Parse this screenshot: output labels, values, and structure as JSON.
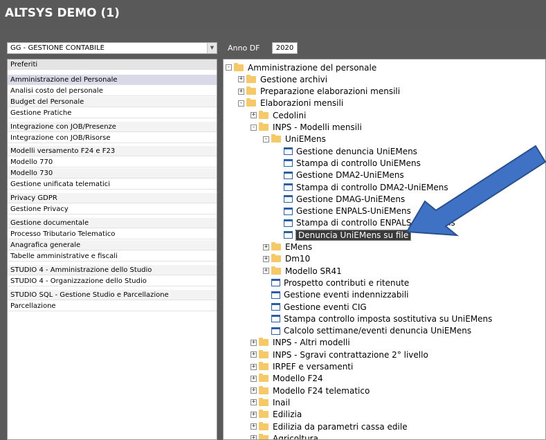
{
  "window": {
    "title": "ALTSYS DEMO (1)"
  },
  "module_select": {
    "value": "GG - GESTIONE CONTABILE"
  },
  "anno": {
    "label": "Anno DF",
    "value": "2020"
  },
  "left_menu": [
    {
      "label": "Preferiti",
      "kind": "header"
    },
    {
      "label": "Amministrazione del Personale",
      "kind": "selected"
    },
    {
      "label": "Analisi costo del personale"
    },
    {
      "label": "Budget del Personale"
    },
    {
      "label": "Gestione Pratiche"
    },
    {
      "label": "Integrazione con JOB/Presenze"
    },
    {
      "label": "Integrazione con JOB/Risorse"
    },
    {
      "label": "Modelli versamento F24 e F23"
    },
    {
      "label": "Modello 770"
    },
    {
      "label": "Modello 730"
    },
    {
      "label": "Gestione unificata telematici"
    },
    {
      "label": "Privacy GDPR"
    },
    {
      "label": "Gestione Privacy"
    },
    {
      "label": "Gestione documentale"
    },
    {
      "label": "Processo Tributario Telematico"
    },
    {
      "label": "Anagrafica generale"
    },
    {
      "label": "Tabelle amministrative e fiscali"
    },
    {
      "label": "STUDIO 4 - Amministrazione dello Studio"
    },
    {
      "label": "STUDIO 4 - Organizzazione dello Studio"
    },
    {
      "label": "STUDIO SQL - Gestione Studio e Parcellazione"
    },
    {
      "label": "Parcellazione"
    }
  ],
  "tree": [
    {
      "label": "Amministrazione del personale",
      "icon": "folder",
      "toggle": "-"
    },
    {
      "label": "Gestione archivi",
      "icon": "folder",
      "toggle": "+"
    },
    {
      "label": "Preparazione elaborazioni mensili",
      "icon": "folder",
      "toggle": "+"
    },
    {
      "label": "Elaborazioni mensili",
      "icon": "folder",
      "toggle": "-"
    },
    {
      "label": "Cedolini",
      "icon": "folder",
      "toggle": "+"
    },
    {
      "label": "INPS - Modelli mensili",
      "icon": "folder",
      "toggle": "-"
    },
    {
      "label": "UniEMens",
      "icon": "folder",
      "toggle": "-"
    },
    {
      "label": "Gestione denuncia UniEMens",
      "icon": "doc"
    },
    {
      "label": "Stampa di controllo UniEMens",
      "icon": "doc"
    },
    {
      "label": "Gestione DMA2-UniEMens",
      "icon": "doc"
    },
    {
      "label": "Stampa di controllo DMA2-UniEMens",
      "icon": "doc"
    },
    {
      "label": "Gestione DMAG-UniEMens",
      "icon": "doc"
    },
    {
      "label": "Gestione ENPALS-UniEMens",
      "icon": "doc"
    },
    {
      "label": "Stampa di controllo ENPALS-UniEMens",
      "icon": "doc"
    },
    {
      "label": "Denuncia UniEMens su file",
      "icon": "doc",
      "selected": true
    },
    {
      "label": "EMens",
      "icon": "folder",
      "toggle": "+"
    },
    {
      "label": "Dm10",
      "icon": "folder",
      "toggle": "+"
    },
    {
      "label": "Modello SR41",
      "icon": "folder",
      "toggle": "+"
    },
    {
      "label": "Prospetto contributi e ritenute",
      "icon": "doc"
    },
    {
      "label": "Gestione eventi indennizzabili",
      "icon": "doc"
    },
    {
      "label": "Gestione eventi CIG",
      "icon": "doc"
    },
    {
      "label": "Stampa controllo imposta sostitutiva su UniEMens",
      "icon": "doc"
    },
    {
      "label": "Calcolo settimane/eventi denuncia UniEMens",
      "icon": "doc"
    },
    {
      "label": "INPS - Altri modelli",
      "icon": "folder",
      "toggle": "+"
    },
    {
      "label": "INPS - Sgravi contrattazione 2° livello",
      "icon": "folder",
      "toggle": "+"
    },
    {
      "label": "IRPEF e versamenti",
      "icon": "folder",
      "toggle": "+"
    },
    {
      "label": "Modello F24",
      "icon": "folder",
      "toggle": "+"
    },
    {
      "label": "Modello F24 telematico",
      "icon": "folder",
      "toggle": "+"
    },
    {
      "label": "Inail",
      "icon": "folder",
      "toggle": "+"
    },
    {
      "label": "Edilizia",
      "icon": "folder",
      "toggle": "+"
    },
    {
      "label": "Edilizia da parametri cassa edile",
      "icon": "folder",
      "toggle": "+"
    },
    {
      "label": "Agricoltura",
      "icon": "folder",
      "toggle": "+"
    }
  ],
  "colors": {
    "arrow": "#3f72c4",
    "arrow_outline": "#2a4f8f",
    "folder": "#f5c967",
    "doc_border": "#2b5fa5"
  }
}
